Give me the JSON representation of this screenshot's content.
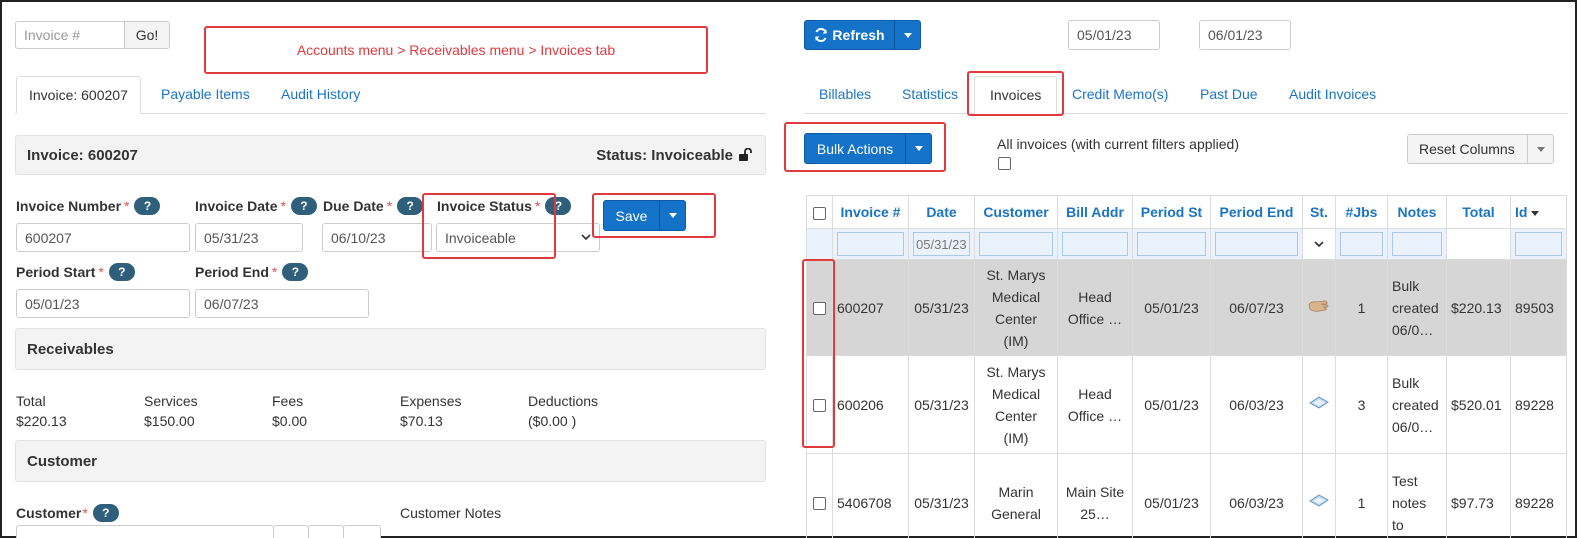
{
  "callout": {
    "text": "Accounts menu > Receivables menu > Invoices tab"
  },
  "invoice_search": {
    "placeholder": "Invoice #",
    "go_label": "Go!"
  },
  "left_tabs": [
    {
      "label": "Invoice: 600207",
      "active": true
    },
    {
      "label": "Payable Items",
      "active": false
    },
    {
      "label": "Audit History",
      "active": false
    }
  ],
  "invoice_panel": {
    "title": "Invoice: 600207",
    "status_text": "Status: Invoiceable"
  },
  "form": {
    "invoice_number": {
      "label": "Invoice Number",
      "value": "600207"
    },
    "invoice_date": {
      "label": "Invoice Date",
      "value": "05/31/23"
    },
    "due_date": {
      "label": "Due Date",
      "value": "06/10/23"
    },
    "invoice_status": {
      "label": "Invoice Status",
      "value": "Invoiceable"
    },
    "period_start": {
      "label": "Period Start",
      "value": "05/01/23"
    },
    "period_end": {
      "label": "Period End",
      "value": "06/07/23"
    },
    "help_glyph": "?",
    "required_mark": "*",
    "save_label": "Save"
  },
  "receivables": {
    "title": "Receivables",
    "items": [
      {
        "label": "Total",
        "value": "$220.13"
      },
      {
        "label": "Services",
        "value": "$150.00"
      },
      {
        "label": "Fees",
        "value": "$0.00"
      },
      {
        "label": "Expenses",
        "value": "$70.13"
      },
      {
        "label": "Deductions",
        "value": "($0.00 )"
      }
    ]
  },
  "customer": {
    "title": "Customer",
    "field_label": "Customer",
    "notes_label": "Customer Notes"
  },
  "right_toolbar": {
    "refresh_label": "Refresh",
    "date_from": "05/01/23",
    "date_to": "06/01/23"
  },
  "right_tabs": [
    {
      "label": "Billables",
      "active": false
    },
    {
      "label": "Statistics",
      "active": false
    },
    {
      "label": "Invoices",
      "active": true
    },
    {
      "label": "Credit Memo(s)",
      "active": false
    },
    {
      "label": "Past Due",
      "active": false
    },
    {
      "label": "Audit Invoices",
      "active": false
    }
  ],
  "bulk": {
    "label": "Bulk Actions",
    "all_invoices_text": "All invoices (with current filters applied)",
    "reset_columns_label": "Reset Columns"
  },
  "table": {
    "columns": [
      "Invoice #",
      "Date",
      "Customer",
      "Bill Addr",
      "Period St",
      "Period End",
      "St.",
      "#Jbs",
      "Notes",
      "Total",
      "Id"
    ],
    "filter_date": "05/31/23",
    "rows": [
      {
        "invoice": "600207",
        "date": "05/31/23",
        "customer": [
          "St. Marys",
          "Medical",
          "Center",
          "(IM)"
        ],
        "bill_addr": [
          "Head",
          "Office …"
        ],
        "period_st": "05/01/23",
        "period_end": "06/07/23",
        "status_icon": "hand-icon",
        "jobs": "1",
        "notes": [
          "Bulk",
          "created",
          "06/0…"
        ],
        "total": "$220.13",
        "id": "89503",
        "selected": true
      },
      {
        "invoice": "600206",
        "date": "05/31/23",
        "customer": [
          "St. Marys",
          "Medical",
          "Center",
          "(IM)"
        ],
        "bill_addr": [
          "Head",
          "Office …"
        ],
        "period_st": "05/01/23",
        "period_end": "06/03/23",
        "status_icon": "paper-icon",
        "jobs": "3",
        "notes": [
          "Bulk",
          "created",
          "06/0…"
        ],
        "total": "$520.01",
        "id": "89228",
        "selected": false
      },
      {
        "invoice": "5406708",
        "date": "05/31/23",
        "customer": [
          "Marin",
          "General"
        ],
        "bill_addr": [
          "Main Site",
          "25…"
        ],
        "period_st": "05/01/23",
        "period_end": "06/03/23",
        "status_icon": "paper-icon",
        "jobs": "1",
        "notes": [
          "Test",
          "notes",
          "to"
        ],
        "total": "$97.73",
        "id": "89228",
        "selected": false
      }
    ]
  },
  "colors": {
    "accent": "#1572c9",
    "callout_red": "#e0393e",
    "link": "#1a74c4"
  }
}
